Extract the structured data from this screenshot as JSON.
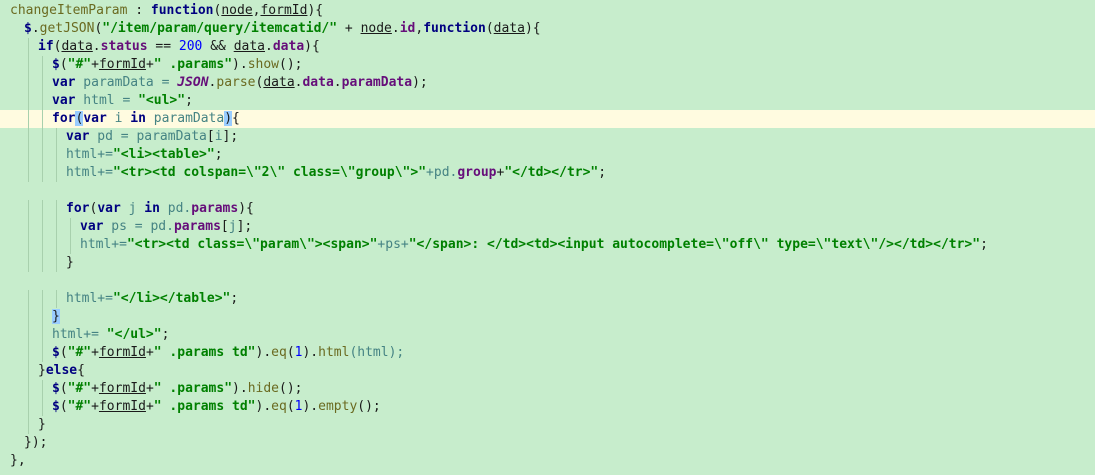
{
  "lines": [
    {
      "indent": 0,
      "tokens": [
        {
          "t": "changeItemParam",
          "c": "fn"
        },
        {
          "t": " : ",
          "c": "op"
        },
        {
          "t": "function",
          "c": "kw"
        },
        {
          "t": "(",
          "c": "op"
        },
        {
          "t": "node",
          "c": "var u"
        },
        {
          "t": ",",
          "c": "op"
        },
        {
          "t": "formId",
          "c": "var u"
        },
        {
          "t": "){",
          "c": "op"
        }
      ]
    },
    {
      "indent": 1,
      "tokens": [
        {
          "t": "$",
          "c": "kw"
        },
        {
          "t": ".",
          "c": "op"
        },
        {
          "t": "getJSON",
          "c": "fn"
        },
        {
          "t": "(",
          "c": "op"
        },
        {
          "t": "\"/item/param/query/itemcatid/\"",
          "c": "str"
        },
        {
          "t": " + ",
          "c": "op"
        },
        {
          "t": "node",
          "c": "var u"
        },
        {
          "t": ".",
          "c": "op"
        },
        {
          "t": "id",
          "c": "prop"
        },
        {
          "t": ",",
          "c": "op"
        },
        {
          "t": "function",
          "c": "kw"
        },
        {
          "t": "(",
          "c": "op"
        },
        {
          "t": "data",
          "c": "var u"
        },
        {
          "t": "){",
          "c": "op"
        }
      ]
    },
    {
      "indent": 2,
      "tokens": [
        {
          "t": "if",
          "c": "kw"
        },
        {
          "t": "(",
          "c": "op"
        },
        {
          "t": "data",
          "c": "var u"
        },
        {
          "t": ".",
          "c": "op"
        },
        {
          "t": "status",
          "c": "prop"
        },
        {
          "t": " == ",
          "c": "op"
        },
        {
          "t": "200",
          "c": "num"
        },
        {
          "t": " && ",
          "c": "op"
        },
        {
          "t": "data",
          "c": "var u"
        },
        {
          "t": ".",
          "c": "op"
        },
        {
          "t": "data",
          "c": "prop"
        },
        {
          "t": "){",
          "c": "op"
        }
      ]
    },
    {
      "indent": 3,
      "tokens": [
        {
          "t": "$",
          "c": "kw"
        },
        {
          "t": "(",
          "c": "op"
        },
        {
          "t": "\"#\"",
          "c": "str"
        },
        {
          "t": "+",
          "c": "op"
        },
        {
          "t": "formId",
          "c": "var u"
        },
        {
          "t": "+",
          "c": "op"
        },
        {
          "t": "\" .params\"",
          "c": "str"
        },
        {
          "t": ").",
          "c": "op"
        },
        {
          "t": "show",
          "c": "fn"
        },
        {
          "t": "();",
          "c": "op"
        }
      ]
    },
    {
      "indent": 3,
      "tokens": [
        {
          "t": "var",
          "c": "kw"
        },
        {
          "t": " paramData = ",
          "c": "lv"
        },
        {
          "t": "JSON",
          "c": "json"
        },
        {
          "t": ".",
          "c": "op"
        },
        {
          "t": "parse",
          "c": "fn"
        },
        {
          "t": "(",
          "c": "op"
        },
        {
          "t": "data",
          "c": "var u"
        },
        {
          "t": ".",
          "c": "op"
        },
        {
          "t": "data",
          "c": "prop"
        },
        {
          "t": ".",
          "c": "op"
        },
        {
          "t": "paramData",
          "c": "prop"
        },
        {
          "t": ");",
          "c": "op"
        }
      ]
    },
    {
      "indent": 3,
      "tokens": [
        {
          "t": "var",
          "c": "kw"
        },
        {
          "t": " html = ",
          "c": "lv"
        },
        {
          "t": "\"<ul>\"",
          "c": "str"
        },
        {
          "t": ";",
          "c": "op"
        }
      ]
    },
    {
      "indent": 3,
      "hl": true,
      "tokens": [
        {
          "t": "for",
          "c": "kw"
        },
        {
          "t": "(",
          "c": "op match"
        },
        {
          "t": "var",
          "c": "kw"
        },
        {
          "t": " i ",
          "c": "lv"
        },
        {
          "t": "in",
          "c": "kw"
        },
        {
          "t": " paramData",
          "c": "lv"
        },
        {
          "t": ")",
          "c": "op match"
        },
        {
          "t": "{",
          "c": "op"
        }
      ]
    },
    {
      "indent": 4,
      "tokens": [
        {
          "t": "var",
          "c": "kw"
        },
        {
          "t": " pd = paramData",
          "c": "lv"
        },
        {
          "t": "[",
          "c": "op"
        },
        {
          "t": "i",
          "c": "lv"
        },
        {
          "t": "];",
          "c": "op"
        }
      ]
    },
    {
      "indent": 4,
      "tokens": [
        {
          "t": "html+=",
          "c": "lv"
        },
        {
          "t": "\"<li><table>\"",
          "c": "str"
        },
        {
          "t": ";",
          "c": "op"
        }
      ]
    },
    {
      "indent": 4,
      "tokens": [
        {
          "t": "html+=",
          "c": "lv"
        },
        {
          "t": "\"<tr><td colspan=\\\"2\\\" class=\\\"group\\\">\"",
          "c": "str"
        },
        {
          "t": "+pd.",
          "c": "lv"
        },
        {
          "t": "group",
          "c": "prop"
        },
        {
          "t": "+",
          "c": "op"
        },
        {
          "t": "\"</td></tr>\"",
          "c": "str"
        },
        {
          "t": ";",
          "c": "op"
        }
      ]
    },
    {
      "indent": 0,
      "tokens": []
    },
    {
      "indent": 4,
      "tokens": [
        {
          "t": "for",
          "c": "kw"
        },
        {
          "t": "(",
          "c": "op"
        },
        {
          "t": "var",
          "c": "kw"
        },
        {
          "t": " j ",
          "c": "lv"
        },
        {
          "t": "in",
          "c": "kw"
        },
        {
          "t": " pd.",
          "c": "lv"
        },
        {
          "t": "params",
          "c": "prop"
        },
        {
          "t": "){",
          "c": "op"
        }
      ]
    },
    {
      "indent": 5,
      "tokens": [
        {
          "t": "var",
          "c": "kw"
        },
        {
          "t": " ps = pd.",
          "c": "lv"
        },
        {
          "t": "params",
          "c": "prop"
        },
        {
          "t": "[",
          "c": "op"
        },
        {
          "t": "j",
          "c": "lv"
        },
        {
          "t": "];",
          "c": "op"
        }
      ]
    },
    {
      "indent": 5,
      "tokens": [
        {
          "t": "html+=",
          "c": "lv"
        },
        {
          "t": "\"<tr><td class=\\\"param\\\"><span>\"",
          "c": "str"
        },
        {
          "t": "+ps+",
          "c": "lv"
        },
        {
          "t": "\"</span>: </td><td><input autocomplete=\\\"off\\\" type=\\\"text\\\"/></td></tr>\"",
          "c": "str"
        },
        {
          "t": ";",
          "c": "op"
        }
      ]
    },
    {
      "indent": 4,
      "tokens": [
        {
          "t": "}",
          "c": "op"
        }
      ]
    },
    {
      "indent": 0,
      "tokens": []
    },
    {
      "indent": 4,
      "tokens": [
        {
          "t": "html+=",
          "c": "lv"
        },
        {
          "t": "\"</li></table>\"",
          "c": "str"
        },
        {
          "t": ";",
          "c": "op"
        }
      ]
    },
    {
      "indent": 3,
      "tokens": [
        {
          "t": "}",
          "c": "op match"
        }
      ]
    },
    {
      "indent": 3,
      "tokens": [
        {
          "t": "html+= ",
          "c": "lv"
        },
        {
          "t": "\"</ul>\"",
          "c": "str"
        },
        {
          "t": ";",
          "c": "op"
        }
      ]
    },
    {
      "indent": 3,
      "tokens": [
        {
          "t": "$",
          "c": "kw"
        },
        {
          "t": "(",
          "c": "op"
        },
        {
          "t": "\"#\"",
          "c": "str"
        },
        {
          "t": "+",
          "c": "op"
        },
        {
          "t": "formId",
          "c": "var u"
        },
        {
          "t": "+",
          "c": "op"
        },
        {
          "t": "\" .params td\"",
          "c": "str"
        },
        {
          "t": ").",
          "c": "op"
        },
        {
          "t": "eq",
          "c": "fn"
        },
        {
          "t": "(",
          "c": "op"
        },
        {
          "t": "1",
          "c": "num"
        },
        {
          "t": ").",
          "c": "op"
        },
        {
          "t": "html",
          "c": "fn"
        },
        {
          "t": "(html);",
          "c": "lv"
        }
      ]
    },
    {
      "indent": 2,
      "tokens": [
        {
          "t": "}",
          "c": "op"
        },
        {
          "t": "else",
          "c": "kw"
        },
        {
          "t": "{",
          "c": "op"
        }
      ]
    },
    {
      "indent": 3,
      "tokens": [
        {
          "t": "$",
          "c": "kw"
        },
        {
          "t": "(",
          "c": "op"
        },
        {
          "t": "\"#\"",
          "c": "str"
        },
        {
          "t": "+",
          "c": "op"
        },
        {
          "t": "formId",
          "c": "var u"
        },
        {
          "t": "+",
          "c": "op"
        },
        {
          "t": "\" .params\"",
          "c": "str"
        },
        {
          "t": ").",
          "c": "op"
        },
        {
          "t": "hide",
          "c": "fn"
        },
        {
          "t": "();",
          "c": "op"
        }
      ]
    },
    {
      "indent": 3,
      "tokens": [
        {
          "t": "$",
          "c": "kw"
        },
        {
          "t": "(",
          "c": "op"
        },
        {
          "t": "\"#\"",
          "c": "str"
        },
        {
          "t": "+",
          "c": "op"
        },
        {
          "t": "formId",
          "c": "var u"
        },
        {
          "t": "+",
          "c": "op"
        },
        {
          "t": "\" .params td\"",
          "c": "str"
        },
        {
          "t": ").",
          "c": "op"
        },
        {
          "t": "eq",
          "c": "fn"
        },
        {
          "t": "(",
          "c": "op"
        },
        {
          "t": "1",
          "c": "num"
        },
        {
          "t": ").",
          "c": "op"
        },
        {
          "t": "empty",
          "c": "fn"
        },
        {
          "t": "();",
          "c": "op"
        }
      ]
    },
    {
      "indent": 2,
      "tokens": [
        {
          "t": "}",
          "c": "op"
        }
      ]
    },
    {
      "indent": 1,
      "tokens": [
        {
          "t": "});",
          "c": "op"
        }
      ]
    },
    {
      "indent": 0,
      "tokens": [
        {
          "t": "},",
          "c": "op"
        }
      ]
    }
  ],
  "colors": {
    "background": "#c7edcc",
    "current_line": "#fffbe0",
    "keyword": "#000080",
    "string": "#008000",
    "number": "#0000ff",
    "property": "#660e7a"
  }
}
